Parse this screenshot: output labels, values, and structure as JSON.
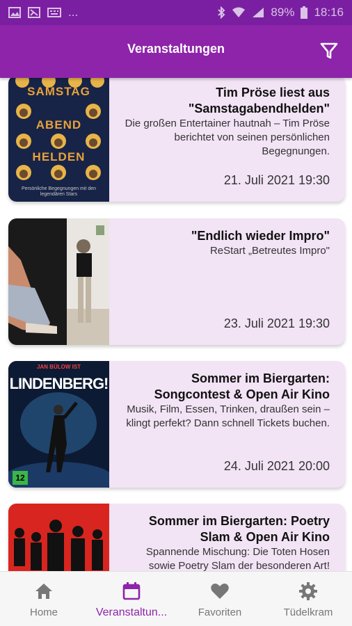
{
  "status_bar": {
    "left_icons": [
      "image-icon",
      "photo-icon",
      "keyboard-icon"
    ],
    "more": "...",
    "battery": "89%",
    "time": "18:16"
  },
  "app_bar": {
    "title": "Veranstaltungen",
    "filter_icon": "filter-icon"
  },
  "events": [
    {
      "title": "Tim Pröse liest aus \"Samstagabendhelden\"",
      "description": "Die großen Entertainer hautnah – Tim Pröse berichtet von seinen persönlichen Begegnungen.",
      "date": "21. Juli 2021 19:30",
      "poster": {
        "line1": "SAMSTAG",
        "line2": "ABEND",
        "line3": "HELDEN",
        "caption": "Persönliche Begegnungen mit den legendären Stars"
      }
    },
    {
      "title": "\"Endlich wieder Impro\"",
      "description": "ReStart „Betreutes Impro\"",
      "date": "23. Juli 2021 19:30"
    },
    {
      "title": "Sommer im Biergarten: Songcontest & Open Air Kino",
      "description": "Musik, Film, Essen, Trinken, draußen sein – klingt perfekt? Dann schnell Tickets buchen.",
      "date": "24. Juli 2021 20:00",
      "poster": {
        "top": "JAN BÜLOW IST",
        "headline": "LINDENBERG!",
        "rating": "12"
      }
    },
    {
      "title": "Sommer im Biergarten: Poetry Slam & Open Air Kino",
      "description": "Spannende Mischung: Die Toten Hosen sowie Poetry Slam der besonderen Art!",
      "date": ""
    }
  ],
  "nav": [
    {
      "label": "Home",
      "icon": "home-icon",
      "active": false
    },
    {
      "label": "Veranstaltun...",
      "icon": "calendar-icon",
      "active": true
    },
    {
      "label": "Favoriten",
      "icon": "heart-icon",
      "active": false
    },
    {
      "label": "Tüdelkram",
      "icon": "gear-icon",
      "active": false
    }
  ],
  "colors": {
    "primary": "#8e24aa",
    "status_bar": "#7b1fa2",
    "card_bg": "#f2e3f5"
  }
}
